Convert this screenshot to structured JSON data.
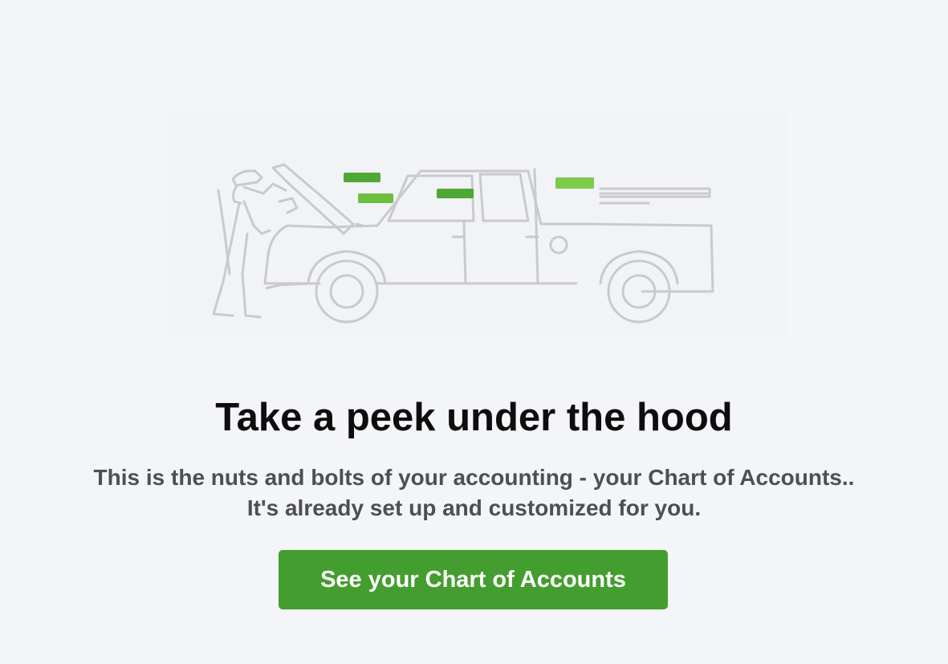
{
  "empty_state": {
    "illustration_icon": "mechanic-truck-hood-icon",
    "title": "Take a peek under the hood",
    "description_line1": "This is the nuts and bolts of your accounting - your Chart of Accounts..",
    "description_line2": "It's already set up and customized for you.",
    "cta_label": "See your Chart of Accounts"
  },
  "colors": {
    "background": "#f4f5f8",
    "button": "#449e2f",
    "title": "#0d0d0d",
    "description": "#4e4f55",
    "line_art": "#c8c9ce",
    "highlight_green": "#5fb83a"
  }
}
